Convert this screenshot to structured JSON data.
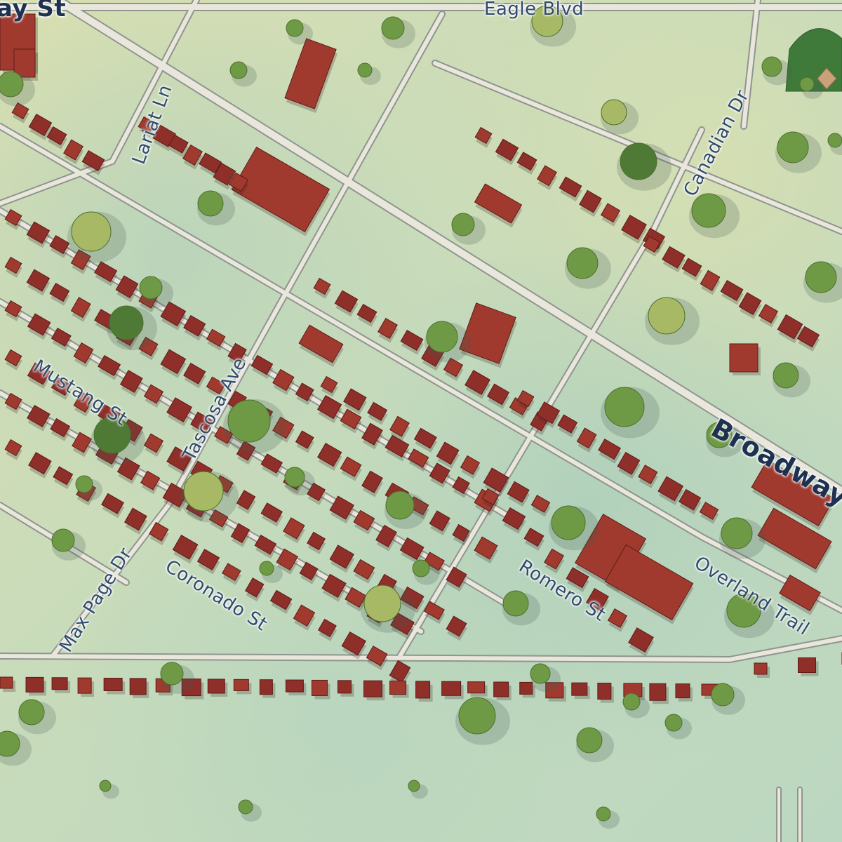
{
  "map": {
    "colors": {
      "land": "#cfdcb6",
      "road": "#e9e7dc",
      "building": "#8e2f2a",
      "tree": "#6f9a45",
      "label": "#2f4a6b"
    },
    "streets": {
      "way_st": "ay St",
      "eagle_blvd": "Eagle Blvd",
      "lariat_ln": "Lariat Ln",
      "canadian_dr": "Canadian Dr",
      "broadway": "Broadway",
      "mustang_st": "Mustang St",
      "tascosa_ave": "Tascosa Ave",
      "max_page_dr": "Max Page Dr",
      "coronado_st": "Coronado St",
      "romero_st": "Romero St",
      "overland_trail": "Overland Trail"
    },
    "features": {
      "baseball_field": "baseball-diamond"
    }
  }
}
